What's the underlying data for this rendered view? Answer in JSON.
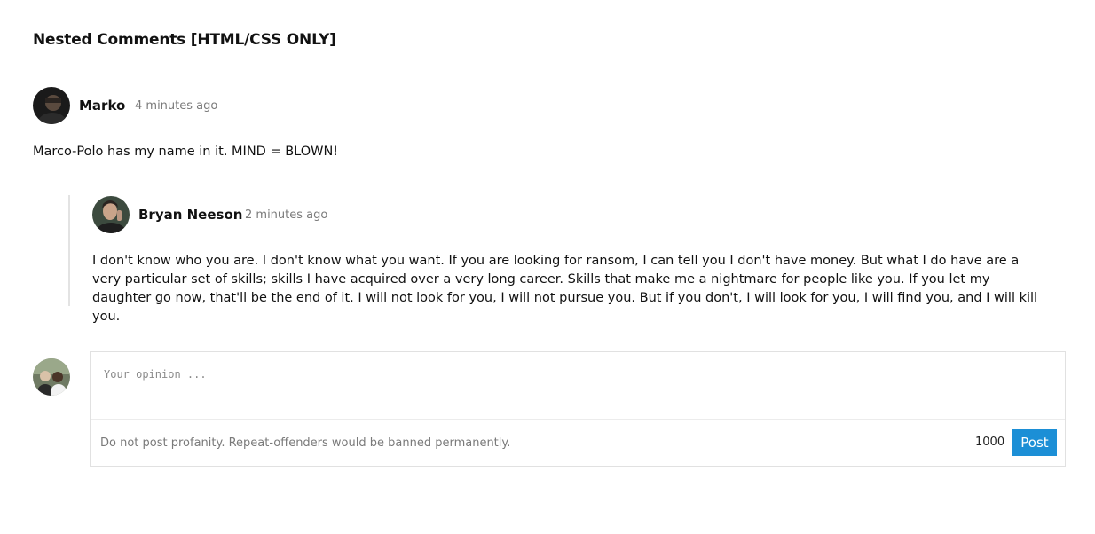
{
  "page": {
    "title": "Nested Comments [HTML/CSS ONLY]"
  },
  "comments": [
    {
      "author": "Marko",
      "time": "4 minutes ago",
      "text": "Marco-Polo has my name in it. MIND = BLOWN!",
      "avatar_icon": "user-avatar-icon",
      "replies": [
        {
          "author": "Bryan Neeson",
          "time": "2 minutes ago",
          "text": "I don't know who you are. I don't know what you want. If you are looking for ransom, I can tell you I don't have money. But what I do have are a very particular set of skills; skills I have acquired over a very long career. Skills that make me a nightmare for people like you. If you let my daughter go now, that'll be the end of it. I will not look for you, I will not pursue you. But if you don't, I will look for you, I will find you, and I will kill you.",
          "avatar_icon": "user-avatar-icon"
        }
      ]
    }
  ],
  "composer": {
    "placeholder": "Your opinion ...",
    "value": "",
    "note": "Do not post profanity. Repeat-offenders would be banned permanently.",
    "char_count": "1000",
    "post_label": "Post",
    "accent_color": "#1c8fd6"
  }
}
